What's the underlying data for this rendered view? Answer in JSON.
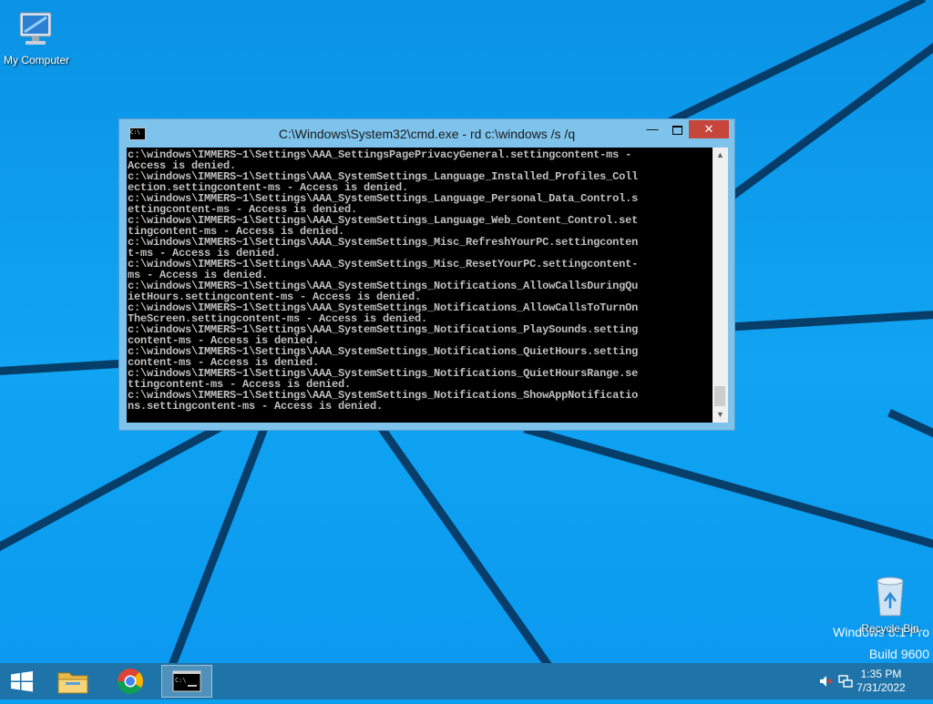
{
  "desktop": {
    "icons": [
      {
        "id": "my-computer",
        "label": "My Computer",
        "icon": "computer-icon"
      },
      {
        "id": "recycle-bin",
        "label": "Recycle Bin",
        "icon": "recycle-bin-icon"
      }
    ],
    "watermark": {
      "line1": "Windows 8.1 Pro",
      "line2": "Build 9600"
    }
  },
  "window": {
    "title": "C:\\Windows\\System32\\cmd.exe - rd  c:\\windows /s /q",
    "icon": "cmd-icon",
    "controls": {
      "minimize": "—",
      "close": "✕"
    },
    "console_lines": [
      "c:\\windows\\IMMERS~1\\Settings\\AAA_SettingsPagePrivacyGeneral.settingcontent-ms -",
      "Access is denied.",
      "c:\\windows\\IMMERS~1\\Settings\\AAA_SystemSettings_Language_Installed_Profiles_Coll",
      "ection.settingcontent-ms - Access is denied.",
      "c:\\windows\\IMMERS~1\\Settings\\AAA_SystemSettings_Language_Personal_Data_Control.s",
      "ettingcontent-ms - Access is denied.",
      "c:\\windows\\IMMERS~1\\Settings\\AAA_SystemSettings_Language_Web_Content_Control.set",
      "tingcontent-ms - Access is denied.",
      "c:\\windows\\IMMERS~1\\Settings\\AAA_SystemSettings_Misc_RefreshYourPC.settingconten",
      "t-ms - Access is denied.",
      "c:\\windows\\IMMERS~1\\Settings\\AAA_SystemSettings_Misc_ResetYourPC.settingcontent-",
      "ms - Access is denied.",
      "c:\\windows\\IMMERS~1\\Settings\\AAA_SystemSettings_Notifications_AllowCallsDuringQu",
      "ietHours.settingcontent-ms - Access is denied.",
      "c:\\windows\\IMMERS~1\\Settings\\AAA_SystemSettings_Notifications_AllowCallsToTurnOn",
      "TheScreen.settingcontent-ms - Access is denied.",
      "c:\\windows\\IMMERS~1\\Settings\\AAA_SystemSettings_Notifications_PlaySounds.setting",
      "content-ms - Access is denied.",
      "c:\\windows\\IMMERS~1\\Settings\\AAA_SystemSettings_Notifications_QuietHours.setting",
      "content-ms - Access is denied.",
      "c:\\windows\\IMMERS~1\\Settings\\AAA_SystemSettings_Notifications_QuietHoursRange.se",
      "ttingcontent-ms - Access is denied.",
      "c:\\windows\\IMMERS~1\\Settings\\AAA_SystemSettings_Notifications_ShowAppNotificatio",
      "ns.settingcontent-ms - Access is denied."
    ]
  },
  "taskbar": {
    "start_icon": "windows-logo-icon",
    "items": [
      {
        "id": "explorer",
        "icon": "file-explorer-icon"
      },
      {
        "id": "chrome",
        "icon": "chrome-icon"
      },
      {
        "id": "cmd",
        "icon": "cmd-icon",
        "active": true
      }
    ],
    "tray": {
      "icons": [
        "speaker-muted-icon",
        "network-icon"
      ],
      "time": "1:35 PM",
      "date": "7/31/2022"
    }
  },
  "colors": {
    "desktop_blue": "#0aa0f0",
    "taskbar": "#1e73a8",
    "window_frame": "#7ec3ec",
    "close_button": "#c7463c",
    "console_bg": "#000000",
    "console_text": "#c0c0c0"
  }
}
